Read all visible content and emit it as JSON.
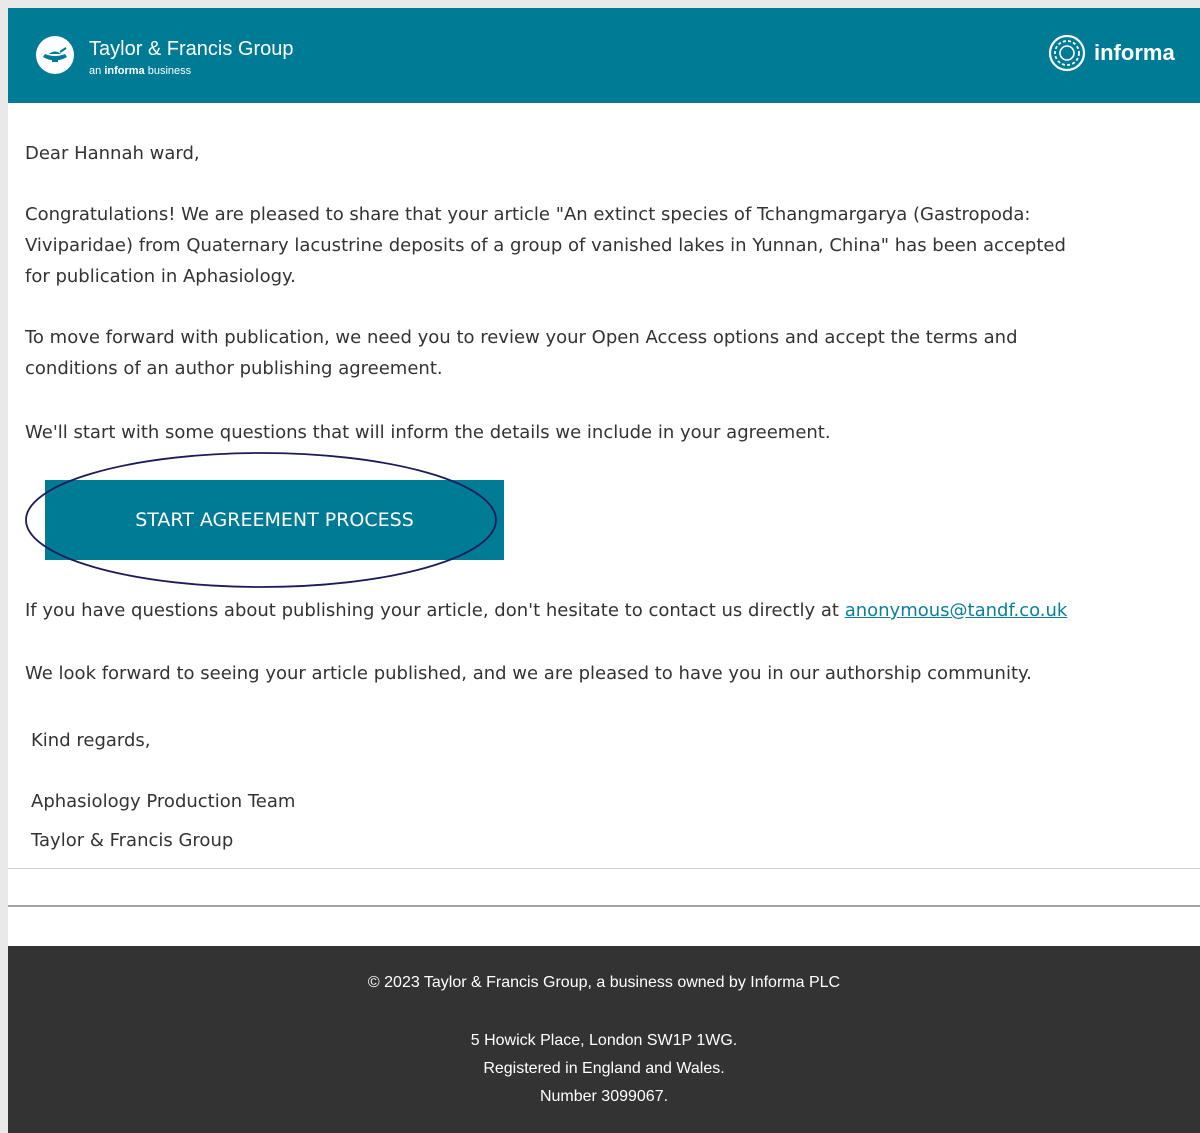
{
  "header": {
    "brand_name": "Taylor & Francis Group",
    "brand_sub_prefix": "an",
    "brand_sub_bold": "informa",
    "brand_sub_suffix": "business",
    "partner_name": "informa",
    "colors": {
      "header_bg": "#007b96",
      "footer_bg": "#333333",
      "link": "#0a7f99"
    },
    "icons": {
      "brand": "taylor-francis-lamp-icon",
      "partner": "informa-circle-icon"
    }
  },
  "email": {
    "greeting": "Dear Hannah ward,",
    "paragraph1_line1": "Congratulations! We are pleased to share that your article \"An extinct species of Tchangmargarya (Gastropoda:",
    "paragraph1_line2": "Viviparidae) from Quaternary lacustrine deposits of a group of vanished lakes in Yunnan, China\" has been accepted",
    "paragraph1_line3": "for publication in Aphasiology.",
    "paragraph2_line1": "To move forward with publication, we need you to review your Open Access options and accept the terms and",
    "paragraph2_line2": "conditions of an author publishing agreement.",
    "paragraph3": "We'll start with some questions that will inform the details we include in your agreement.",
    "cta_label": "START AGREEMENT PROCESS",
    "questions_text": "If you have questions about publishing your article, don't hesitate to contact us directly at ",
    "contact_email": "anonymous@tandf.co.uk",
    "closing_paragraph": "We look forward to seeing your article published, and we are pleased to have you in our authorship community.",
    "sign_off": "Kind regards,",
    "signature_team": "Aphasiology Production Team",
    "signature_org": "Taylor & Francis Group"
  },
  "footer": {
    "copyright": "© 2023 Taylor & Francis Group, a business owned by Informa PLC",
    "address": "5 Howick Place, London SW1P 1WG.",
    "registered": "Registered in England and Wales.",
    "number": "Number 3099067."
  }
}
